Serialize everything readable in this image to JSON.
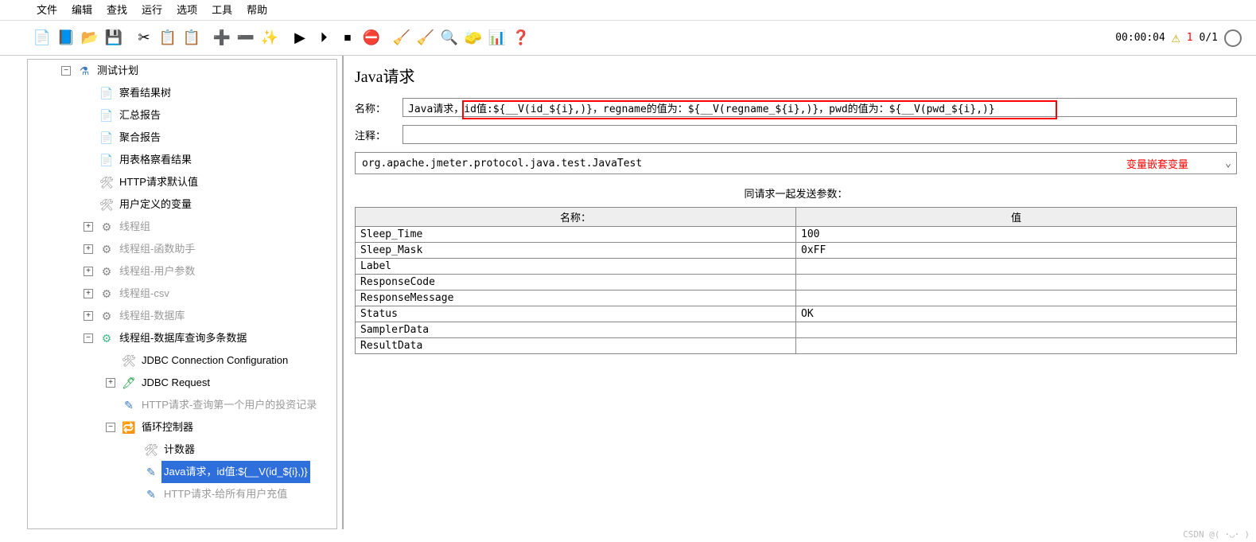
{
  "menubar": [
    "文件",
    "编辑",
    "查找",
    "运行",
    "选项",
    "工具",
    "帮助"
  ],
  "toolbar_icons": [
    {
      "name": "new-icon",
      "glyph": "📄"
    },
    {
      "name": "template-icon",
      "glyph": "📘"
    },
    {
      "name": "open-icon",
      "glyph": "📂"
    },
    {
      "name": "save-icon",
      "glyph": "💾"
    },
    {
      "name": "sep"
    },
    {
      "name": "cut-icon",
      "glyph": "✂"
    },
    {
      "name": "copy-icon",
      "glyph": "📋"
    },
    {
      "name": "paste-icon",
      "glyph": "📋"
    },
    {
      "name": "sep"
    },
    {
      "name": "plus-icon",
      "glyph": "➕"
    },
    {
      "name": "minus-icon",
      "glyph": "➖"
    },
    {
      "name": "wand-icon",
      "glyph": "✨"
    },
    {
      "name": "sep"
    },
    {
      "name": "run-icon",
      "glyph": "▶"
    },
    {
      "name": "run-no-icon",
      "glyph": "⏵"
    },
    {
      "name": "stop-icon",
      "glyph": "⏹"
    },
    {
      "name": "shutdown-icon",
      "glyph": "⛔"
    },
    {
      "name": "sep"
    },
    {
      "name": "clear-icon",
      "glyph": "🧹"
    },
    {
      "name": "clear-all-icon",
      "glyph": "🧹"
    },
    {
      "name": "search-icon",
      "glyph": "🔍"
    },
    {
      "name": "clear-search-icon",
      "glyph": "🧽"
    },
    {
      "name": "function-icon",
      "glyph": "📊"
    },
    {
      "name": "help-icon",
      "glyph": "❓"
    }
  ],
  "toolbar_right": {
    "time": "00:00:04",
    "warn_count": "1",
    "ratio": "0/1"
  },
  "tree": [
    {
      "lvl": 0,
      "exp": "−",
      "icon": "ic-flask",
      "label": "测试计划",
      "name": "tree-test-plan"
    },
    {
      "lvl": 1,
      "exp": "",
      "icon": "ic-res",
      "label": "察看结果树",
      "name": "tree-view-results"
    },
    {
      "lvl": 1,
      "exp": "",
      "icon": "ic-res",
      "label": "汇总报告",
      "name": "tree-summary-report"
    },
    {
      "lvl": 1,
      "exp": "",
      "icon": "ic-res",
      "label": "聚合报告",
      "name": "tree-aggregate-report"
    },
    {
      "lvl": 1,
      "exp": "",
      "icon": "ic-res",
      "label": "用表格察看结果",
      "name": "tree-view-table"
    },
    {
      "lvl": 1,
      "exp": "",
      "icon": "ic-wrench",
      "label": "HTTP请求默认值",
      "name": "tree-http-defaults"
    },
    {
      "lvl": 1,
      "exp": "",
      "icon": "ic-wrench",
      "label": "用户定义的变量",
      "name": "tree-user-vars"
    },
    {
      "lvl": 1,
      "exp": "+",
      "icon": "ic-gear",
      "label": "线程组",
      "gray": true,
      "name": "tree-threadgroup"
    },
    {
      "lvl": 1,
      "exp": "+",
      "icon": "ic-gear",
      "label": "线程组-函数助手",
      "gray": true,
      "name": "tree-tg-func"
    },
    {
      "lvl": 1,
      "exp": "+",
      "icon": "ic-gear",
      "label": "线程组-用户参数",
      "gray": true,
      "name": "tree-tg-userparam"
    },
    {
      "lvl": 1,
      "exp": "+",
      "icon": "ic-gear",
      "label": "线程组-csv",
      "gray": true,
      "name": "tree-tg-csv"
    },
    {
      "lvl": 1,
      "exp": "+",
      "icon": "ic-gear",
      "label": "线程组-数据库",
      "gray": true,
      "name": "tree-tg-db"
    },
    {
      "lvl": 1,
      "exp": "−",
      "icon": "ic-gearb",
      "label": "线程组-数据库查询多条数据",
      "name": "tree-tg-dbmulti"
    },
    {
      "lvl": 2,
      "exp": "",
      "icon": "ic-wrench",
      "label": "JDBC Connection Configuration",
      "name": "tree-jdbc-conn"
    },
    {
      "lvl": 2,
      "exp": "+",
      "icon": "ic-jdbc",
      "label": "JDBC Request",
      "name": "tree-jdbc-req"
    },
    {
      "lvl": 2,
      "exp": "",
      "icon": "ic-pen",
      "label": "HTTP请求-查询第一个用户的投资记录",
      "gray": true,
      "name": "tree-http-query"
    },
    {
      "lvl": 2,
      "exp": "−",
      "icon": "ic-loop",
      "label": "循环控制器",
      "name": "tree-loop"
    },
    {
      "lvl": 3,
      "exp": "",
      "icon": "ic-wrench",
      "label": "计数器",
      "name": "tree-counter"
    },
    {
      "lvl": 3,
      "exp": "",
      "icon": "ic-pen",
      "label": "Java请求，id值:${__V(id_${i},)}",
      "sel": true,
      "name": "tree-java-req"
    },
    {
      "lvl": 3,
      "exp": "",
      "icon": "ic-pen",
      "label": "HTTP请求-给所有用户充值",
      "gray": true,
      "name": "tree-http-recharge"
    }
  ],
  "panel": {
    "title": "Java请求",
    "name_label": "名称：",
    "name_value": "Java请求，id值:${__V(id_${i},)}，regname的值为：${__V(regname_${i},)}，pwd的值为：${__V(pwd_${i},)}",
    "comment_label": "注释：",
    "comment_value": "",
    "classname": "org.apache.jmeter.protocol.java.test.JavaTest",
    "annotation": "变量嵌套变量",
    "params_title": "同请求一起发送参数：",
    "columns": [
      "名称：",
      "值"
    ],
    "params": [
      {
        "name": "Sleep_Time",
        "value": "100"
      },
      {
        "name": "Sleep_Mask",
        "value": "0xFF"
      },
      {
        "name": "Label",
        "value": ""
      },
      {
        "name": "ResponseCode",
        "value": ""
      },
      {
        "name": "ResponseMessage",
        "value": ""
      },
      {
        "name": "Status",
        "value": "OK"
      },
      {
        "name": "SamplerData",
        "value": ""
      },
      {
        "name": "ResultData",
        "value": ""
      }
    ]
  },
  "footer": "CSDN @( ･◡･ )"
}
